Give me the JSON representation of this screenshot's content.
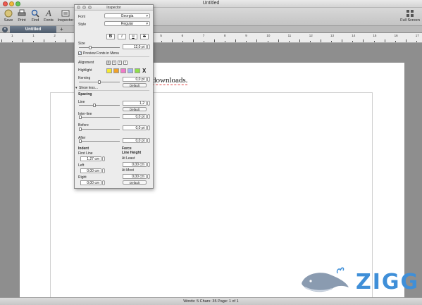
{
  "window": {
    "title": "Untitled"
  },
  "toolbar": {
    "items": [
      {
        "label": "Save"
      },
      {
        "label": "Print"
      },
      {
        "label": "Find"
      },
      {
        "label": "Fonts"
      },
      {
        "label": "Inspector"
      }
    ],
    "fullscreen_label": "Full Screen"
  },
  "tab": {
    "label": "Untitled",
    "add_symbol": "+"
  },
  "ruler": {
    "labels": [
      "1",
      "1",
      "2",
      "1",
      "2",
      "3",
      "4",
      "5",
      "6",
      "7",
      "8",
      "9",
      "10",
      "11",
      "12",
      "13",
      "14",
      "15",
      "16",
      "17"
    ]
  },
  "document": {
    "text": "downloads."
  },
  "inspector": {
    "title": "Inspector",
    "font_label": "Font",
    "font_value": "Georgia",
    "style_label": "Style",
    "style_value": "Regular",
    "format_buttons": [
      "B",
      "i",
      "u",
      "S"
    ],
    "size_label": "Size",
    "size_value": "12,0 pt",
    "preview_label": "Preview Fonts in Menu",
    "preview_checked": true,
    "alignment_label": "Alignment",
    "highlight_label": "Highlight",
    "highlight_colors": [
      "#f4e932",
      "#f0a22a",
      "#f07ac8",
      "#9fb4f0",
      "#8fe04a"
    ],
    "highlight_clear": "X",
    "kerning_label": "Kerning",
    "kerning_value": "0,0 pt",
    "kerning_default": "Default",
    "show_less": "Show less...",
    "spacing_label": "Spacing",
    "line_label": "Line",
    "line_value": "1,2",
    "line_default": "Default",
    "interline_label": "Inter-line",
    "interline_value": "0,0 pt",
    "before_label": "Before",
    "before_value": "0,0 pt",
    "after_label": "After",
    "after_value": "0,0 pt",
    "indent_label": "Indent",
    "first_line_label": "First Line",
    "first_line_value": "1,27 cm",
    "left_label": "Left",
    "left_value": "0,00 cm",
    "right_label": "Right",
    "right_value": "0,00 cm",
    "force_label": "Force",
    "line_height_label": "Line Height",
    "at_least_label": "At Least",
    "at_least_value": "0,00 cm",
    "at_most_label": "At Most",
    "at_most_value": "0,00 cm",
    "lh_default": "Default"
  },
  "status": {
    "text": "Words: 5  Chars: 35  Page: 1 of 1"
  },
  "watermark": {
    "text": "ZIGG"
  },
  "colors": {
    "accent": "#3f8fd8",
    "tab": "#5a6878"
  }
}
